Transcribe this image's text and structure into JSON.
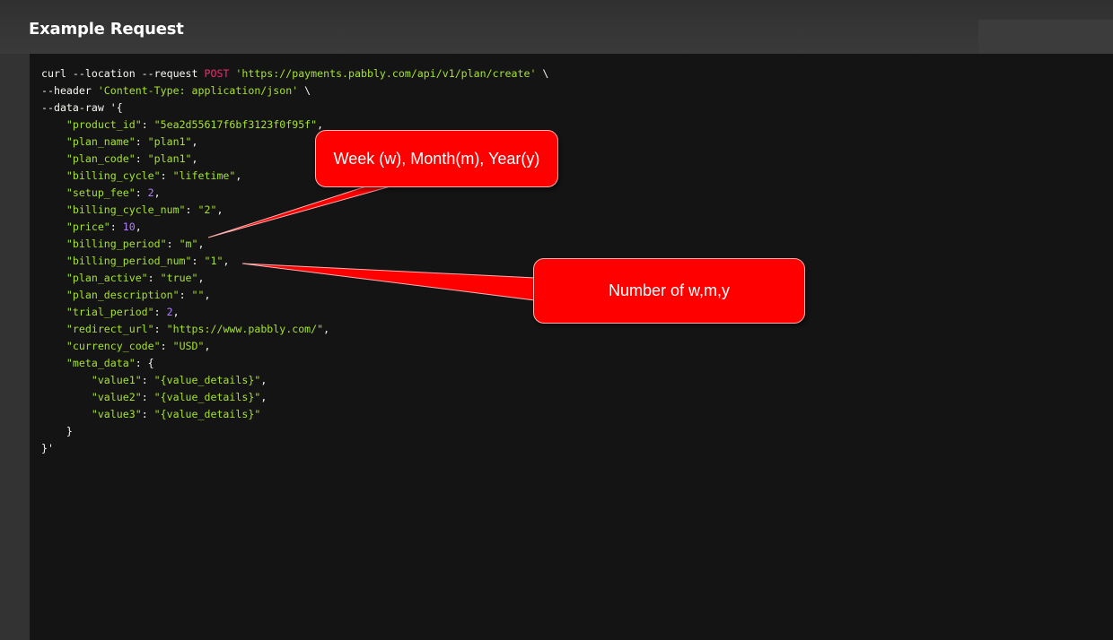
{
  "header": {
    "title": "Example Request"
  },
  "code": {
    "curl_cmd": "curl --location --request ",
    "method": "POST",
    "url": "'https://payments.pabbly.com/api/v1/plan/create'",
    "line1_tail": " \\",
    "header_flag": "--header ",
    "header_value": "'Content-Type: application/json'",
    "line2_tail": " \\",
    "data_raw": "--data-raw '{",
    "fields": [
      {
        "key": "\"product_id\"",
        "value": "\"5ea2d55617f6bf3123f0f95f\"",
        "type": "string"
      },
      {
        "key": "\"plan_name\"",
        "value": "\"plan1\"",
        "type": "string"
      },
      {
        "key": "\"plan_code\"",
        "value": "\"plan1\"",
        "type": "string"
      },
      {
        "key": "\"billing_cycle\"",
        "value": "\"lifetime\"",
        "type": "string"
      },
      {
        "key": "\"setup_fee\"",
        "value": "2",
        "type": "number"
      },
      {
        "key": "\"billing_cycle_num\"",
        "value": "\"2\"",
        "type": "string"
      },
      {
        "key": "\"price\"",
        "value": "10",
        "type": "number"
      },
      {
        "key": "\"billing_period\"",
        "value": "\"m\"",
        "type": "string"
      },
      {
        "key": "\"billing_period_num\"",
        "value": "\"1\"",
        "type": "string"
      },
      {
        "key": "\"plan_active\"",
        "value": "\"true\"",
        "type": "string"
      },
      {
        "key": "\"plan_description\"",
        "value": "\"\"",
        "type": "string"
      },
      {
        "key": "\"trial_period\"",
        "value": "2",
        "type": "number"
      },
      {
        "key": "\"redirect_url\"",
        "value": "\"https://www.pabbly.com/\"",
        "type": "string"
      },
      {
        "key": "\"currency_code\"",
        "value": "\"USD\"",
        "type": "string"
      }
    ],
    "meta_key": "\"meta_data\"",
    "meta_fields": [
      {
        "key": "\"value1\"",
        "value": "\"{value_details}\""
      },
      {
        "key": "\"value2\"",
        "value": "\"{value_details}\""
      },
      {
        "key": "\"value3\"",
        "value": "\"{value_details}\""
      }
    ],
    "meta_close": "}",
    "end": "}'"
  },
  "callouts": {
    "billing_period_note": "Week (w), Month(m), Year(y)",
    "billing_period_num_note": "Number of w,m,y"
  },
  "colors": {
    "callout": "#ff0000",
    "string": "#a6e22e",
    "number": "#ae81ff",
    "method": "#f92672",
    "code_bg": "#141414"
  }
}
